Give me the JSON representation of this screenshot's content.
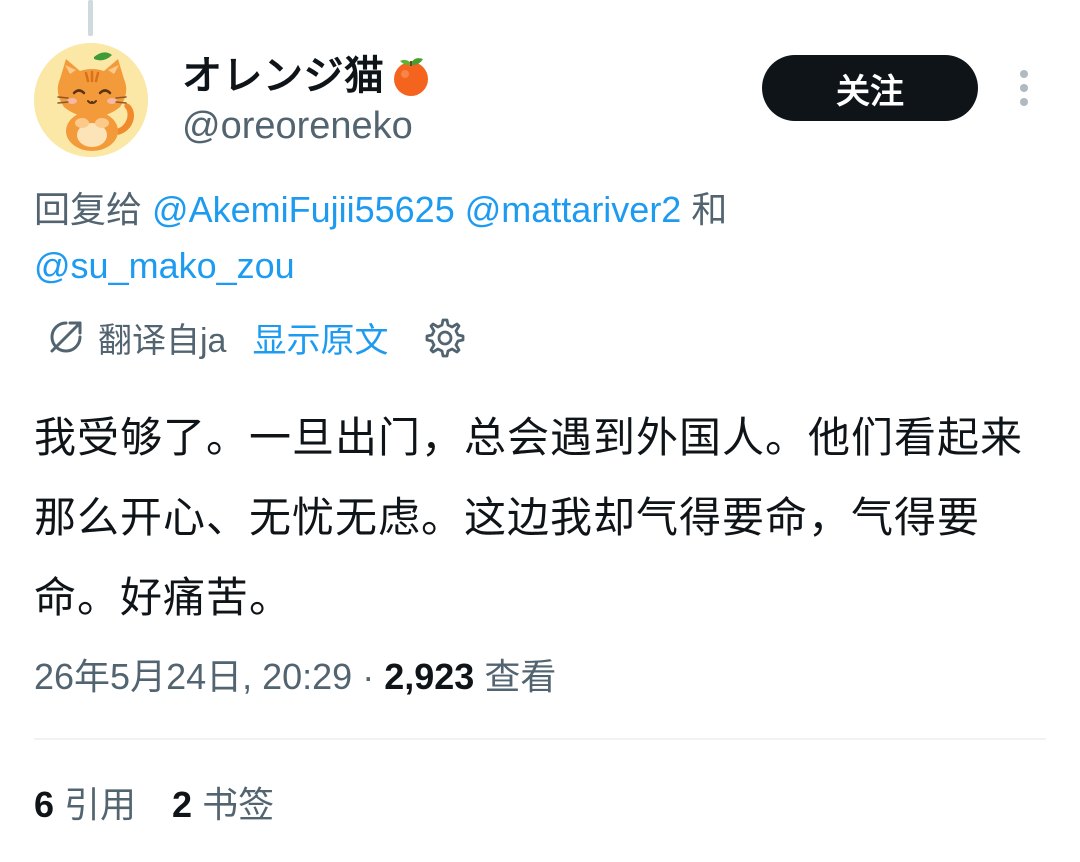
{
  "author": {
    "display_name": "オレンジ猫",
    "name_emoji": "tangerine-emoji",
    "handle": "@oreoreneko",
    "avatar": "orange-cat-avatar"
  },
  "header": {
    "follow_label": "关注",
    "more_icon": "more-vertical-icon"
  },
  "reply": {
    "prefix": "回复给",
    "mentions": [
      "@AkemiFujii55625",
      "@mattariver2",
      "@su_mako_zou"
    ],
    "conjunction": "和"
  },
  "translation": {
    "icon": "translate-icon",
    "translated_from": "翻译自ja",
    "show_original": "显示原文",
    "settings_icon": "gear-icon"
  },
  "tweet": {
    "text": "我受够了。一旦出门，总会遇到外国人。他们看起来那么开心、无忧无虑。这边我却气得要命，气得要命。好痛苦。"
  },
  "meta": {
    "timestamp": "26年5月24日, 20:29",
    "separator": "·",
    "views_count": "2,923",
    "views_label": "查看"
  },
  "stats": {
    "quotes_count": "6",
    "quotes_label": "引用",
    "bookmarks_count": "2",
    "bookmarks_label": "书签"
  },
  "colors": {
    "link": "#1d9bf0",
    "secondary_text": "#536471",
    "primary_text": "#0f1419",
    "button_bg": "#0f1419"
  }
}
